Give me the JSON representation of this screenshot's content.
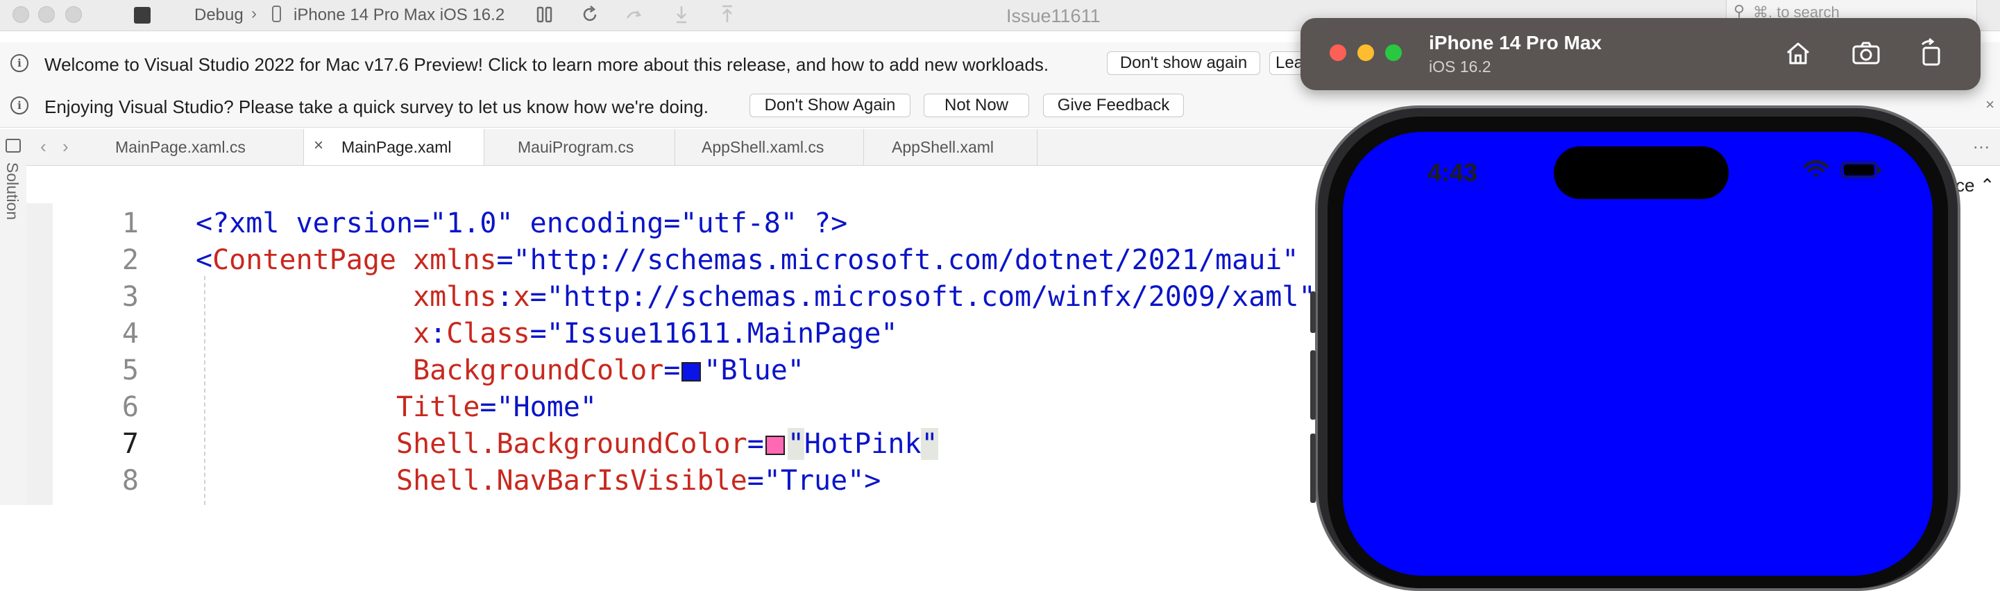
{
  "titlebar": {
    "config": "Debug",
    "breadcrumb_sep": "›",
    "device": "iPhone 14 Pro Max iOS 16.2",
    "window_title": "Issue11611",
    "search_placeholder": "⌘. to search"
  },
  "infobar1": {
    "message": "Welcome to Visual Studio 2022 for Mac v17.6 Preview! Click to learn more about this release, and how to add new workloads.",
    "dont_show": "Don't show again",
    "learn_more": "Learn more"
  },
  "infobar2": {
    "message": "Enjoying Visual Studio? Please take a quick survey to let us know how we're doing.",
    "dont_show": "Don't Show Again",
    "not_now": "Not Now",
    "give_feedback": "Give Feedback",
    "close": "×"
  },
  "solution_pad": {
    "label": "Solution"
  },
  "tabs": [
    {
      "label": "MainPage.xaml.cs"
    },
    {
      "label": "MainPage.xaml"
    },
    {
      "label": "MauiProgram.cs"
    },
    {
      "label": "AppShell.xaml.cs"
    },
    {
      "label": "AppShell.xaml"
    }
  ],
  "editor": {
    "current_line": 7,
    "right_label": "ce",
    "lines": [
      {
        "n": "1",
        "tokens": [
          {
            "t": "<?xml version=\"1.0\" encoding=\"utf-8\" ?>",
            "c": "blue"
          }
        ]
      },
      {
        "n": "2",
        "tokens": [
          {
            "t": "<",
            "c": "blue"
          },
          {
            "t": "ContentPage",
            "c": "red"
          },
          {
            "t": " xmlns",
            "c": "red"
          },
          {
            "t": "=\"http://schemas.microsoft.com/dotnet/2021/maui\"",
            "c": "blue"
          }
        ]
      },
      {
        "n": "3",
        "tokens": [
          {
            "t": "             xmlns",
            "c": "red"
          },
          {
            "t": ":",
            "c": "blue"
          },
          {
            "t": "x",
            "c": "red"
          },
          {
            "t": "=\"http://schemas.microsoft.com/winfx/2009/xaml\"",
            "c": "blue"
          }
        ]
      },
      {
        "n": "4",
        "tokens": [
          {
            "t": "             x",
            "c": "red"
          },
          {
            "t": ":",
            "c": "blue"
          },
          {
            "t": "Class",
            "c": "red"
          },
          {
            "t": "=\"Issue11611.MainPage\"",
            "c": "blue"
          }
        ]
      },
      {
        "n": "5",
        "tokens": [
          {
            "t": "             BackgroundColor",
            "c": "red"
          },
          {
            "t": "=",
            "c": "blue"
          },
          {
            "swatch": "#0a14e6"
          },
          {
            "t": "\"Blue\"",
            "c": "blue"
          }
        ]
      },
      {
        "n": "6",
        "tokens": [
          {
            "t": "            Title",
            "c": "red"
          },
          {
            "t": "=\"Home\"",
            "c": "blue"
          }
        ]
      },
      {
        "n": "7",
        "tokens": [
          {
            "t": "            Shell.BackgroundColor",
            "c": "red"
          },
          {
            "t": "=",
            "c": "blue"
          },
          {
            "swatch": "#ff69b4"
          },
          {
            "t": "\"",
            "c": "blue",
            "hl": true
          },
          {
            "t": "HotPink",
            "c": "blue"
          },
          {
            "t": "\"",
            "c": "blue",
            "hl": true
          }
        ]
      },
      {
        "n": "8",
        "tokens": [
          {
            "t": "            Shell.NavBarIsVisible",
            "c": "red"
          },
          {
            "t": "=\"True\">",
            "c": "blue"
          }
        ]
      }
    ]
  },
  "simulator": {
    "device_name": "iPhone 14 Pro Max",
    "os": "iOS 16.2",
    "status_time": "4:43",
    "screen_color": "#0000ff"
  },
  "colors": {
    "keyword_blue": "#0a14c8",
    "attr_red": "#c8281e",
    "swatch_blue": "#0a14e6",
    "swatch_hotpink": "#ff69b4"
  }
}
